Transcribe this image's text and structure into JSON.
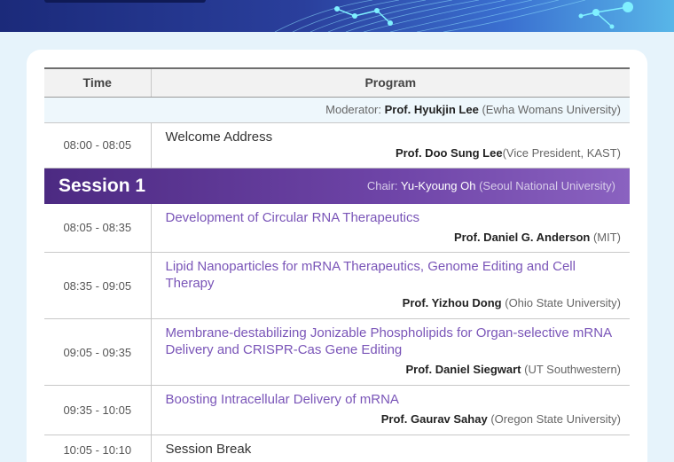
{
  "header": {
    "time": "Time",
    "program": "Program"
  },
  "moderator": {
    "label": "Moderator:",
    "name": "Prof. Hyukjin Lee",
    "affil": "(Ewha Womans University)"
  },
  "welcome": {
    "time": "08:00 - 08:05",
    "title": "Welcome Address",
    "speaker": "Prof. Doo Sung Lee",
    "affil": "(Vice President, KAST)"
  },
  "session1": {
    "name": "Session 1",
    "chair_label": "Chair:",
    "chair_name": "Yu-Kyoung Oh",
    "chair_affil": "(Seoul National University)"
  },
  "talks": [
    {
      "time": "08:05 - 08:35",
      "title": "Development of Circular RNA Therapeutics",
      "speaker": "Prof. Daniel G. Anderson",
      "affil": "(MIT)"
    },
    {
      "time": "08:35 - 09:05",
      "title": "Lipid Nanoparticles for mRNA Therapeutics, Genome Editing and Cell Therapy",
      "speaker": "Prof. Yizhou Dong",
      "affil": "(Ohio State University)"
    },
    {
      "time": "09:05 - 09:35",
      "title": "Membrane-destabilizing Jonizable Phospholipids for Organ-selective mRNA Delivery and CRISPR-Cas Gene Editing",
      "speaker": "Prof. Daniel Siegwart",
      "affil": "(UT Southwestern)"
    },
    {
      "time": "09:35 - 10:05",
      "title": "Boosting Intracellular Delivery of mRNA",
      "speaker": "Prof. Gaurav Sahay",
      "affil": "(Oregon State University)"
    }
  ],
  "break": {
    "time": "10:05 - 10:10",
    "title": "Session Break"
  }
}
